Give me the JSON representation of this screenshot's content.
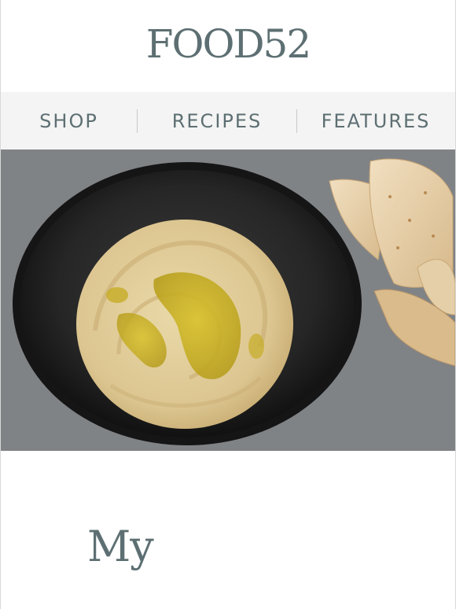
{
  "brand": {
    "logo_text": "FOOD52"
  },
  "nav": {
    "items": [
      {
        "label": "SHOP"
      },
      {
        "label": "RECIPES"
      },
      {
        "label": "FEATURES"
      }
    ]
  },
  "hero": {
    "image": "hummus-bowl-with-olive-oil-and-pita"
  },
  "article": {
    "heading": "My"
  },
  "colors": {
    "brand": "#5d6f72",
    "nav_bg": "#f4f4f4"
  }
}
